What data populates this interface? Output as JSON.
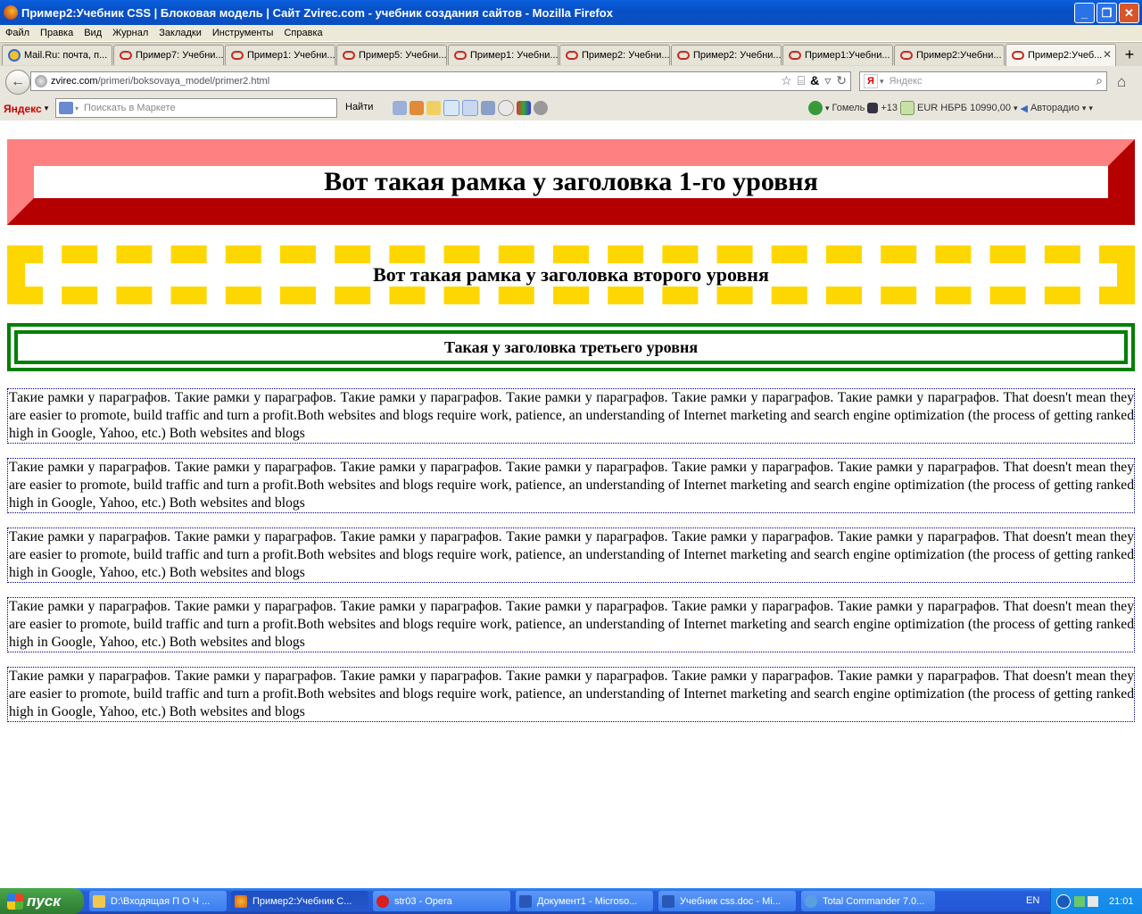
{
  "window": {
    "title": "Пример2:Учебник CSS | Блоковая модель | Сайт Zvirec.com - учебник создания сайтов - Mozilla Firefox",
    "buttons": {
      "minimize": "_",
      "maximize": "❐",
      "close": "✕"
    }
  },
  "menu": [
    "Файл",
    "Правка",
    "Вид",
    "Журнал",
    "Закладки",
    "Инструменты",
    "Справка"
  ],
  "tabs": [
    {
      "label": "Mail.Ru: почта, п...",
      "icon": "mailru-icon"
    },
    {
      "label": "Пример7: Учебни...",
      "icon": "zvirec-icon"
    },
    {
      "label": "Пример1: Учебни...",
      "icon": "zvirec-icon"
    },
    {
      "label": "Пример5: Учебни...",
      "icon": "zvirec-icon"
    },
    {
      "label": "Пример1: Учебни...",
      "icon": "zvirec-icon"
    },
    {
      "label": "Пример2: Учебни...",
      "icon": "zvirec-icon"
    },
    {
      "label": "Пример2: Учебни...",
      "icon": "zvirec-icon"
    },
    {
      "label": "Пример1:Учебни...",
      "icon": "zvirec-icon"
    },
    {
      "label": "Пример2:Учебни...",
      "icon": "zvirec-icon"
    },
    {
      "label": "Пример2:Учеб...",
      "icon": "zvirec-icon",
      "active": true
    }
  ],
  "newtab": "+",
  "nav": {
    "url_host": "zvirec.com",
    "url_path": "/primeri/boksovaya_model/primer2.html",
    "search_placeholder": "Яндекс",
    "search_engine": "Я"
  },
  "yandexbar": {
    "logo": "Яндекс",
    "market_placeholder": "Поискать в Маркете",
    "find": "Найти",
    "city": "Гомель",
    "weather": "+13",
    "currency": "EUR НБРБ 10990,00",
    "radio": "Авторадио"
  },
  "page": {
    "h1": "Вот такая рамка у заголовка 1-го уровня",
    "h2": "Вот такая рамка у заголовка второго уровня",
    "h3": "Такая у заголовка третьего уровня",
    "paragraph": "Такие рамки у параграфов. Такие рамки у параграфов. Такие рамки у параграфов. Такие рамки у параграфов. Такие рамки у параграфов. Такие рамки у параграфов. That doesn't mean they are easier to promote, build traffic and turn a profit.Both websites and blogs require work, patience, an understanding of Internet marketing and search engine optimization (the process of getting ranked high in Google, Yahoo, etc.) Both websites and blogs",
    "colors": {
      "h1_light": "#ff8080",
      "h1_dark": "#b40000",
      "h2_dash": "#ffd700",
      "h3_double": "#008000",
      "para_border": "#000080"
    }
  },
  "taskbar": {
    "start": "пуск",
    "tasks": [
      {
        "label": "D:\\Входящая  П О Ч ...",
        "icon": "folder-icon"
      },
      {
        "label": "Пример2:Учебник С...",
        "icon": "firefox-icon",
        "active": true
      },
      {
        "label": "str03 - Opera",
        "icon": "opera-icon"
      },
      {
        "label": "Документ1 - Microso...",
        "icon": "word-icon"
      },
      {
        "label": "Учебник css.doc - Mi...",
        "icon": "word-icon"
      },
      {
        "label": "Total Commander 7.0...",
        "icon": "totalcmd-icon"
      }
    ],
    "lang": "EN",
    "clock": "21:01"
  }
}
